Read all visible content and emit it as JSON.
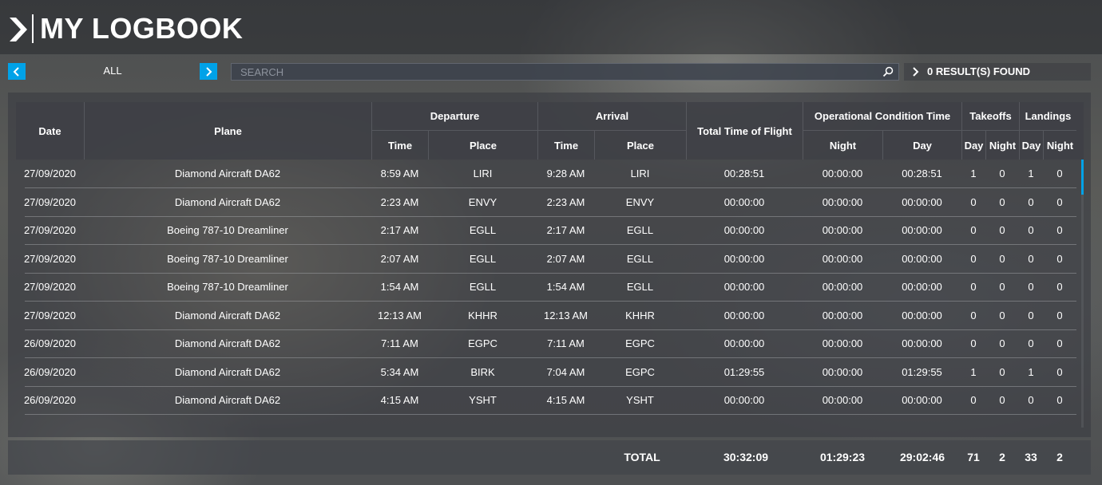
{
  "header": {
    "title": "MY LOGBOOK"
  },
  "filter": {
    "label": "ALL"
  },
  "search": {
    "placeholder": "SEARCH",
    "value": ""
  },
  "results": {
    "text": "0 RESULT(S) FOUND"
  },
  "table": {
    "headers": {
      "date": "Date",
      "plane": "Plane",
      "departure": "Departure",
      "arrival": "Arrival",
      "total_time": "Total Time of Flight",
      "operational": "Operational Condition Time",
      "takeoffs": "Takeoffs",
      "landings": "Landings",
      "time": "Time",
      "place": "Place",
      "night": "Night",
      "day": "Day"
    },
    "rows": [
      {
        "date": "27/09/2020",
        "plane": "Diamond Aircraft DA62",
        "dep_time": "8:59 AM",
        "dep_place": "LIRI",
        "arr_time": "9:28 AM",
        "arr_place": "LIRI",
        "total": "00:28:51",
        "op_night": "00:00:00",
        "op_day": "00:28:51",
        "to_day": "1",
        "to_night": "0",
        "ld_day": "1",
        "ld_night": "0"
      },
      {
        "date": "27/09/2020",
        "plane": "Diamond Aircraft DA62",
        "dep_time": "2:23 AM",
        "dep_place": "ENVY",
        "arr_time": "2:23 AM",
        "arr_place": "ENVY",
        "total": "00:00:00",
        "op_night": "00:00:00",
        "op_day": "00:00:00",
        "to_day": "0",
        "to_night": "0",
        "ld_day": "0",
        "ld_night": "0"
      },
      {
        "date": "27/09/2020",
        "plane": "Boeing 787-10 Dreamliner",
        "dep_time": "2:17 AM",
        "dep_place": "EGLL",
        "arr_time": "2:17 AM",
        "arr_place": "EGLL",
        "total": "00:00:00",
        "op_night": "00:00:00",
        "op_day": "00:00:00",
        "to_day": "0",
        "to_night": "0",
        "ld_day": "0",
        "ld_night": "0"
      },
      {
        "date": "27/09/2020",
        "plane": "Boeing 787-10 Dreamliner",
        "dep_time": "2:07 AM",
        "dep_place": "EGLL",
        "arr_time": "2:07 AM",
        "arr_place": "EGLL",
        "total": "00:00:00",
        "op_night": "00:00:00",
        "op_day": "00:00:00",
        "to_day": "0",
        "to_night": "0",
        "ld_day": "0",
        "ld_night": "0"
      },
      {
        "date": "27/09/2020",
        "plane": "Boeing 787-10 Dreamliner",
        "dep_time": "1:54 AM",
        "dep_place": "EGLL",
        "arr_time": "1:54 AM",
        "arr_place": "EGLL",
        "total": "00:00:00",
        "op_night": "00:00:00",
        "op_day": "00:00:00",
        "to_day": "0",
        "to_night": "0",
        "ld_day": "0",
        "ld_night": "0"
      },
      {
        "date": "27/09/2020",
        "plane": "Diamond Aircraft DA62",
        "dep_time": "12:13 AM",
        "dep_place": "KHHR",
        "arr_time": "12:13 AM",
        "arr_place": "KHHR",
        "total": "00:00:00",
        "op_night": "00:00:00",
        "op_day": "00:00:00",
        "to_day": "0",
        "to_night": "0",
        "ld_day": "0",
        "ld_night": "0"
      },
      {
        "date": "26/09/2020",
        "plane": "Diamond Aircraft DA62",
        "dep_time": "7:11 AM",
        "dep_place": "EGPC",
        "arr_time": "7:11 AM",
        "arr_place": "EGPC",
        "total": "00:00:00",
        "op_night": "00:00:00",
        "op_day": "00:00:00",
        "to_day": "0",
        "to_night": "0",
        "ld_day": "0",
        "ld_night": "0"
      },
      {
        "date": "26/09/2020",
        "plane": "Diamond Aircraft DA62",
        "dep_time": "5:34 AM",
        "dep_place": "BIRK",
        "arr_time": "7:04 AM",
        "arr_place": "EGPC",
        "total": "01:29:55",
        "op_night": "00:00:00",
        "op_day": "01:29:55",
        "to_day": "1",
        "to_night": "0",
        "ld_day": "1",
        "ld_night": "0"
      },
      {
        "date": "26/09/2020",
        "plane": "Diamond Aircraft DA62",
        "dep_time": "4:15 AM",
        "dep_place": "YSHT",
        "arr_time": "4:15 AM",
        "arr_place": "YSHT",
        "total": "00:00:00",
        "op_night": "00:00:00",
        "op_day": "00:00:00",
        "to_day": "0",
        "to_night": "0",
        "ld_day": "0",
        "ld_night": "0"
      }
    ]
  },
  "totals": {
    "label": "TOTAL",
    "total_time": "30:32:09",
    "op_night": "01:29:23",
    "op_day": "29:02:46",
    "to_day": "71",
    "to_night": "2",
    "ld_day": "33",
    "ld_night": "2"
  },
  "colors": {
    "accent": "#00a2e8"
  }
}
